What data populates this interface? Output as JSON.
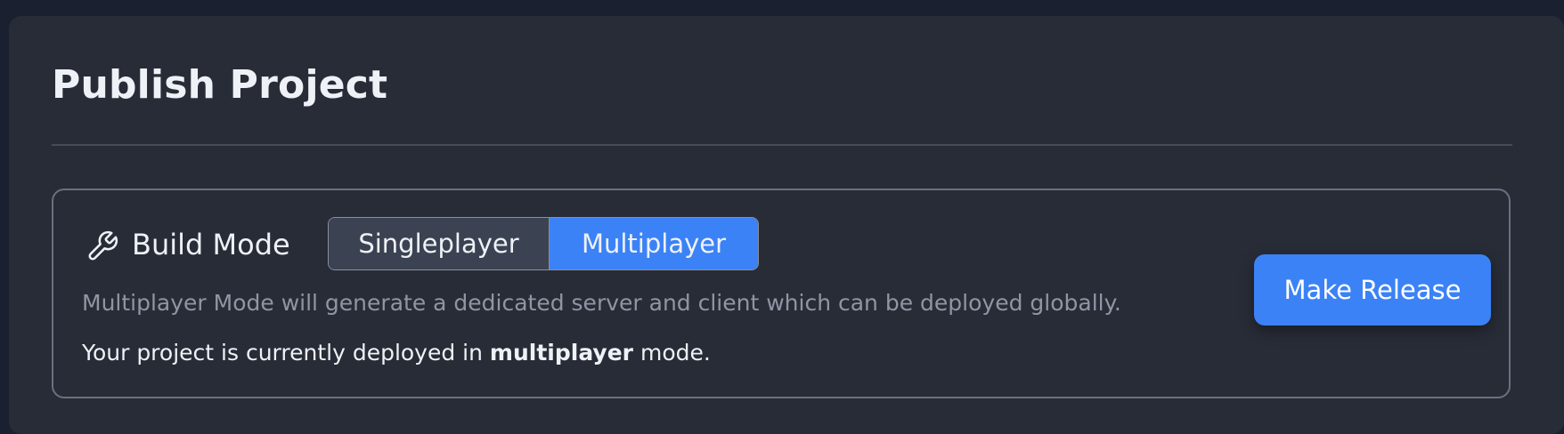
{
  "page": {
    "title": "Publish Project"
  },
  "build_mode": {
    "label": "Build Mode",
    "icon": "wrench-icon",
    "options": [
      "Singleplayer",
      "Multiplayer"
    ],
    "selected": "Multiplayer",
    "description": "Multiplayer Mode will generate a dedicated server and client which can be deployed globally.",
    "status_prefix": "Your project is currently deployed in ",
    "status_mode": "multiplayer",
    "status_suffix": " mode."
  },
  "actions": {
    "release_label": "Make Release"
  },
  "colors": {
    "accent": "#3b82f6",
    "panel_bg": "#282c37",
    "page_bg": "#1b2030"
  }
}
